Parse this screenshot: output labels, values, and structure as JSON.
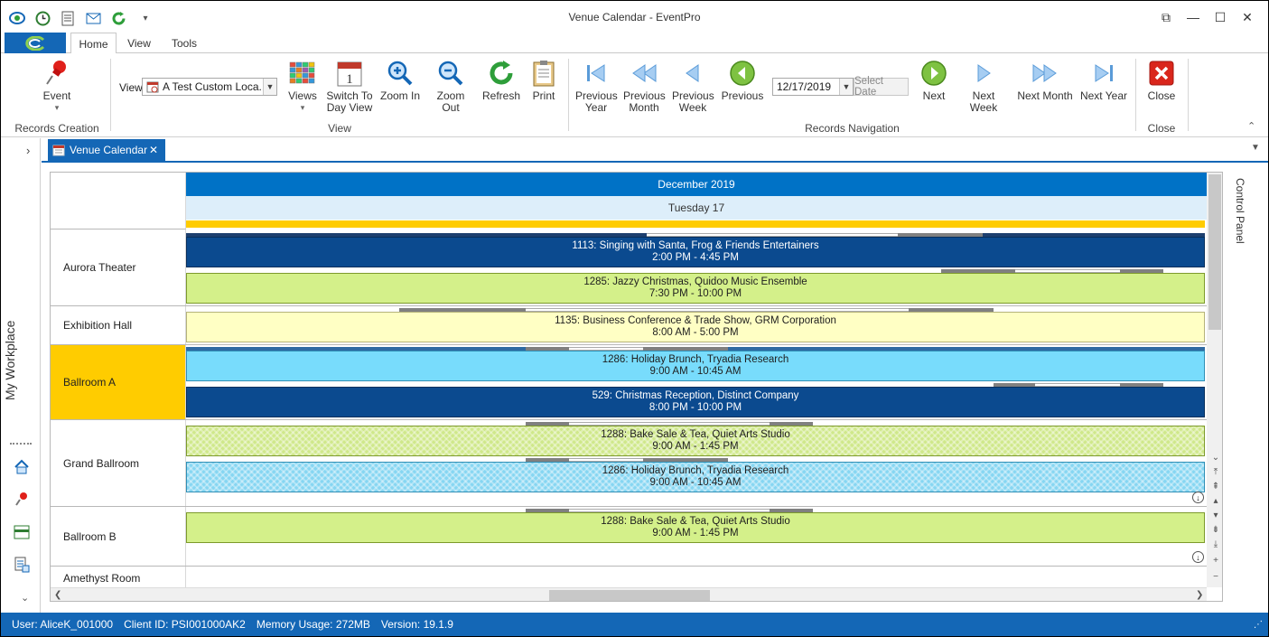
{
  "window": {
    "title": "Venue Calendar - EventPro",
    "restore_glyph": "⧉",
    "minimize_glyph": "—",
    "maximize_glyph": "☐",
    "close_glyph": "✕"
  },
  "ribbon_tabs": [
    "Home",
    "View",
    "Tools"
  ],
  "ribbon": {
    "event_label": "Event",
    "records_creation_label": "Records Creation",
    "view_prefix": "View",
    "view_value": "A Test Custom Loca...",
    "views_label": "Views",
    "switch_label_1": "Switch To",
    "switch_label_2": "Day View",
    "zoom_in_label": "Zoom In",
    "zoom_out_label": "Zoom Out",
    "refresh_label": "Refresh",
    "print_label": "Print",
    "view_group_label": "View",
    "prev_year_1": "Previous",
    "prev_year_2": "Year",
    "prev_month_1": "Previous",
    "prev_month_2": "Month",
    "prev_week_1": "Previous",
    "prev_week_2": "Week",
    "previous_label": "Previous",
    "date_value": "12/17/2019",
    "select_date_label": "Select Date",
    "next_label": "Next",
    "next_week_label": "Next Week",
    "next_month_label": "Next Month",
    "next_year_label": "Next Year",
    "records_nav_label": "Records Navigation",
    "close_label": "Close",
    "close_group_label": "Close"
  },
  "sidebar": {
    "workplace_label": "My Workplace"
  },
  "doc_tab": {
    "label": "Venue Calendar",
    "close_glyph": "✕"
  },
  "calendar": {
    "month": "December 2019",
    "day": "Tuesday 17",
    "resources": [
      {
        "name": "Aurora Theater"
      },
      {
        "name": "Exhibition Hall"
      },
      {
        "name": "Ballroom A"
      },
      {
        "name": "Grand Ballroom"
      },
      {
        "name": "Ballroom B"
      },
      {
        "name": "Amethyst Room"
      }
    ],
    "events": [
      {
        "title": "1113: Singing with Santa, Frog & Friends Entertainers",
        "time": "2:00 PM - 4:45 PM"
      },
      {
        "title": "1285: Jazzy Christmas, Quidoo Music Ensemble",
        "time": "7:30 PM - 10:00 PM"
      },
      {
        "title": "1135: Business Conference & Trade Show, GRM Corporation",
        "time": "8:00 AM - 5:00 PM"
      },
      {
        "title": "1286: Holiday Brunch, Tryadia Research",
        "time": "9:00 AM - 10:45 AM"
      },
      {
        "title": "529: Christmas Reception, Distinct Company",
        "time": "8:00 PM - 10:00 PM"
      },
      {
        "title": "1288: Bake Sale & Tea, Quiet Arts Studio",
        "time": "9:00 AM - 1:45 PM"
      },
      {
        "title": "1286: Holiday Brunch, Tryadia Research",
        "time": "9:00 AM - 10:45 AM"
      },
      {
        "title": "1288: Bake Sale & Tea, Quiet Arts Studio",
        "time": "9:00 AM - 1:45 PM"
      }
    ]
  },
  "control_panel_label": "Control Panel",
  "status": {
    "user": "User: AliceK_001000",
    "client": "Client ID: PSI001000AK2",
    "memory": "Memory Usage: 272MB",
    "version": "Version: 19.1.9"
  }
}
